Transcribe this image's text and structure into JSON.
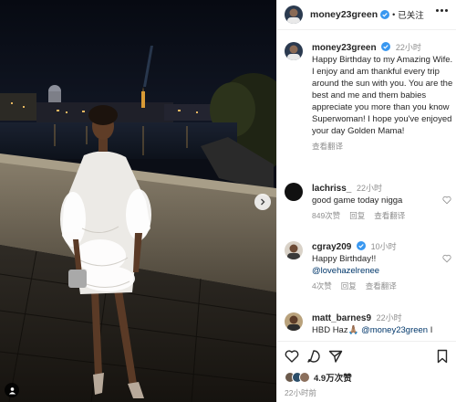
{
  "header": {
    "username": "money23green",
    "separator": "•",
    "follow_status": "已关注"
  },
  "caption": {
    "username": "money23green",
    "time": "22小时",
    "text": "Happy Birthday to my Amazing Wife. I enjoy and am thankful every trip around the sun with you. You are the best and me and them babies appreciate you more than you know Superwoman! I hope you've enjoyed your day Golden Mama!",
    "translate": "查看翻译"
  },
  "comments": [
    {
      "username": "lachriss_",
      "time": "22小时",
      "text": "good game today nigga",
      "likes": "849次赞",
      "reply": "回复",
      "translate": "查看翻译"
    },
    {
      "username": "cgray209",
      "time": "10小时",
      "text": "Happy Birthday!!",
      "mention": "@lovehazelrenee",
      "likes": "4次赞",
      "reply": "回复",
      "translate": "查看翻译"
    },
    {
      "username": "matt_barnes9",
      "time": "22小时",
      "text_prefix": "HBD Haz🙏🏽",
      "mention": "@money23green",
      "text_suffix": "I"
    }
  ],
  "footer": {
    "likes_count": "4.9万次赞",
    "post_time": "22小时前"
  },
  "icons": {
    "heart": "heart-icon",
    "comment": "comment-icon",
    "share": "share-icon",
    "save": "bookmark-icon",
    "verified": "verified-badge-icon",
    "more": "more-options-icon",
    "next": "chevron-right-icon",
    "tag": "user-tag-icon"
  },
  "colors": {
    "verified": "#3897f0",
    "mention": "#00376b",
    "muted": "#8e8e8e"
  }
}
